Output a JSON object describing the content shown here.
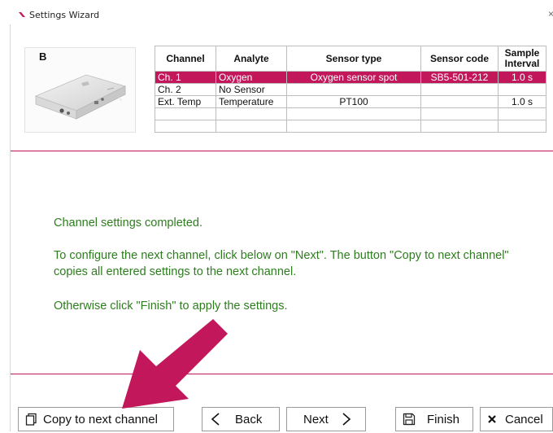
{
  "window": {
    "title": "Settings Wizard",
    "close_glyph": "×"
  },
  "device": {
    "label": "B"
  },
  "table": {
    "headers": [
      "Channel",
      "Analyte",
      "Sensor type",
      "Sensor code",
      "Sample Interval"
    ],
    "header_lines": {
      "sample_1": "Sample",
      "sample_2": "Interval"
    },
    "rows": [
      {
        "channel": "Ch. 1",
        "analyte": "Oxygen",
        "sensor_type": "Oxygen sensor spot",
        "sensor_code": "SB5-501-212",
        "interval": "1.0 s"
      },
      {
        "channel": "Ch. 2",
        "analyte": "No Sensor",
        "sensor_type": "",
        "sensor_code": "",
        "interval": ""
      },
      {
        "channel": "Ext. Temp",
        "analyte": "Temperature",
        "sensor_type": "PT100",
        "sensor_code": "",
        "interval": "1.0 s"
      }
    ],
    "selected_color": "#c2185b"
  },
  "message": {
    "line1": "Channel settings completed.",
    "line2": "To configure the next channel, click below on \"Next\". The button \"Copy to next channel\" copies all entered settings to the next channel.",
    "line3": "Otherwise click \"Finish\" to apply the settings.",
    "color": "#2e7d1f"
  },
  "buttons": {
    "copy": "Copy to next channel",
    "back": "Back",
    "next": "Next",
    "finish": "Finish",
    "cancel": "Cancel"
  },
  "icons": {
    "copy": "copy-icon",
    "back": "chevron-left-icon",
    "next": "chevron-right-icon",
    "finish": "save-icon",
    "cancel": "close-icon"
  }
}
